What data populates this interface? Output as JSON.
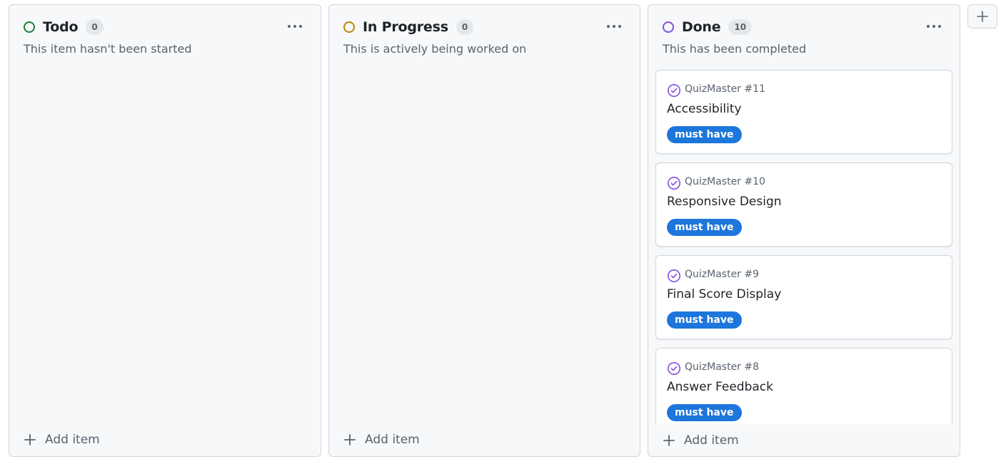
{
  "columns": [
    {
      "title": "Todo",
      "count": "0",
      "description": "This item hasn't been started",
      "status_color": "#1a7f37",
      "add_label": "Add item"
    },
    {
      "title": "In Progress",
      "count": "0",
      "description": "This is actively being worked on",
      "status_color": "#bf8700",
      "add_label": "Add item"
    },
    {
      "title": "Done",
      "count": "10",
      "description": "This has been completed",
      "status_color": "#8250df",
      "add_label": "Add item",
      "cards": [
        {
          "ref": "QuizMaster #11",
          "title": "Accessibility",
          "label": "must have"
        },
        {
          "ref": "QuizMaster #10",
          "title": "Responsive Design",
          "label": "must have"
        },
        {
          "ref": "QuizMaster #9",
          "title": "Final Score Display",
          "label": "must have"
        },
        {
          "ref": "QuizMaster #8",
          "title": "Answer Feedback",
          "label": "must have"
        }
      ]
    }
  ],
  "colors": {
    "label_must_have": "#1d76db",
    "closed_issue_icon": "#8250df"
  },
  "icons": {
    "more": "kebab-horizontal-icon",
    "add": "plus-icon",
    "closed_issue": "issue-closed-icon"
  }
}
